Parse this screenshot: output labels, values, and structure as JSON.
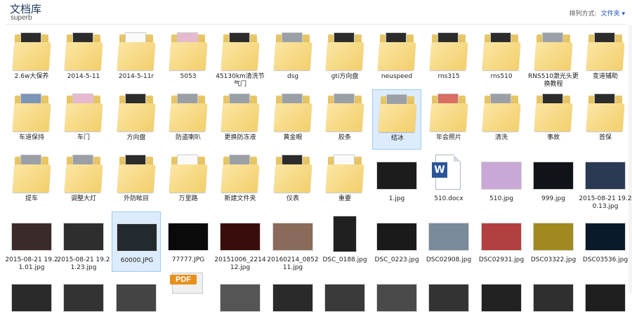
{
  "header": {
    "title": "文档库",
    "subtitle": "superb",
    "arrange_label": "排列方式:",
    "arrange_value": "文件夹"
  },
  "items": [
    {
      "label": "2.6w大保养",
      "kind": "folder",
      "tint": "dark"
    },
    {
      "label": "2014-5-11",
      "kind": "folder",
      "tint": "dark"
    },
    {
      "label": "2014-5-11r",
      "kind": "folder",
      "tint": "white"
    },
    {
      "label": "5053",
      "kind": "folder",
      "tint": "pink"
    },
    {
      "label": "45130km清洗节气门",
      "kind": "folder",
      "tint": "dark"
    },
    {
      "label": "dsg",
      "kind": "folder",
      "tint": "grey"
    },
    {
      "label": "gti方向盘",
      "kind": "folder",
      "tint": "dark"
    },
    {
      "label": "neuspeed",
      "kind": "folder",
      "tint": "dark"
    },
    {
      "label": "rns315",
      "kind": "folder",
      "tint": "dark"
    },
    {
      "label": "rns510",
      "kind": "folder",
      "tint": "dark"
    },
    {
      "label": "RNS510激光头更换教程",
      "kind": "folder",
      "tint": "grey"
    },
    {
      "label": "变道辅助",
      "kind": "folder",
      "tint": "dark"
    },
    {
      "label": "车道保持",
      "kind": "folder",
      "tint": "blue"
    },
    {
      "label": "车门",
      "kind": "folder",
      "tint": "pink"
    },
    {
      "label": "方向盘",
      "kind": "folder",
      "tint": "dark"
    },
    {
      "label": "防盗喇叭",
      "kind": "folder",
      "tint": "grey"
    },
    {
      "label": "更换防冻液",
      "kind": "folder",
      "tint": "grey"
    },
    {
      "label": "黄金眼",
      "kind": "folder",
      "tint": "grey"
    },
    {
      "label": "胶条",
      "kind": "folder",
      "tint": "grey"
    },
    {
      "label": "结冰",
      "kind": "folder",
      "tint": "grey",
      "selected": true
    },
    {
      "label": "年会照片",
      "kind": "folder",
      "tint": "red"
    },
    {
      "label": "清洗",
      "kind": "folder",
      "tint": "grey"
    },
    {
      "label": "事故",
      "kind": "folder",
      "tint": "dark"
    },
    {
      "label": "首保",
      "kind": "folder",
      "tint": "dark"
    },
    {
      "label": "提车",
      "kind": "folder",
      "tint": "grey"
    },
    {
      "label": "调整大灯",
      "kind": "folder",
      "tint": "grey"
    },
    {
      "label": "外防眩目",
      "kind": "folder",
      "tint": "dark"
    },
    {
      "label": "万里路",
      "kind": "folder",
      "tint": "white"
    },
    {
      "label": "新建文件夹",
      "kind": "folder",
      "tint": "grey"
    },
    {
      "label": "仪表",
      "kind": "folder",
      "tint": "dark"
    },
    {
      "label": "重要",
      "kind": "folder",
      "tint": "white"
    },
    {
      "label": "1.jpg",
      "kind": "image",
      "color": "#1c1c1c"
    },
    {
      "label": "510.docx",
      "kind": "docx"
    },
    {
      "label": "510.jpg",
      "kind": "image",
      "color": "#c9a8d8"
    },
    {
      "label": "999.jpg",
      "kind": "image",
      "color": "#101418"
    },
    {
      "label": "2015-08-21 19.20.13.jpg",
      "kind": "image",
      "color": "#2a3a52"
    },
    {
      "label": "2015-08-21 19.21.01.jpg",
      "kind": "image",
      "color": "#3b2a2a"
    },
    {
      "label": "2015-08-21 19.21.23.jpg",
      "kind": "image",
      "color": "#2e2e2e"
    },
    {
      "label": "60000.JPG",
      "kind": "image",
      "color": "#222a30",
      "selected": true
    },
    {
      "label": "77777.JPG",
      "kind": "image",
      "color": "#0a0a0a"
    },
    {
      "label": "20151006_221412.jpg",
      "kind": "image",
      "color": "#3a0d0d"
    },
    {
      "label": "20160214_085211.jpg",
      "kind": "image",
      "color": "#8a6a5a"
    },
    {
      "label": "DSC_0188.jpg",
      "kind": "image",
      "color": "#202020",
      "tall": true
    },
    {
      "label": "DSC_0223.jpg",
      "kind": "image",
      "color": "#1a1a1a"
    },
    {
      "label": "DSC02908.jpg",
      "kind": "image",
      "color": "#7a8a9a"
    },
    {
      "label": "DSC02931.jpg",
      "kind": "image",
      "color": "#b24040"
    },
    {
      "label": "DSC03322.jpg",
      "kind": "image",
      "color": "#a08a20"
    },
    {
      "label": "DSC03536.jpg",
      "kind": "image",
      "color": "#0a1a2a"
    },
    {
      "label": "",
      "kind": "image",
      "color": "#2a2a2a"
    },
    {
      "label": "",
      "kind": "image",
      "color": "#333333"
    },
    {
      "label": "",
      "kind": "image",
      "color": "#444444"
    },
    {
      "label": "",
      "kind": "pdf",
      "badge": "PDF"
    },
    {
      "label": "",
      "kind": "image",
      "color": "#555555"
    },
    {
      "label": "",
      "kind": "image",
      "color": "#2a2a2a"
    },
    {
      "label": "",
      "kind": "image",
      "color": "#3a3a3a"
    },
    {
      "label": "",
      "kind": "image",
      "color": "#4a4a4a"
    },
    {
      "label": "",
      "kind": "image",
      "color": "#333333"
    },
    {
      "label": "",
      "kind": "image",
      "color": "#222222"
    },
    {
      "label": "",
      "kind": "image",
      "color": "#2f2f2f"
    },
    {
      "label": "",
      "kind": "image",
      "color": "#1f1f1f"
    }
  ]
}
